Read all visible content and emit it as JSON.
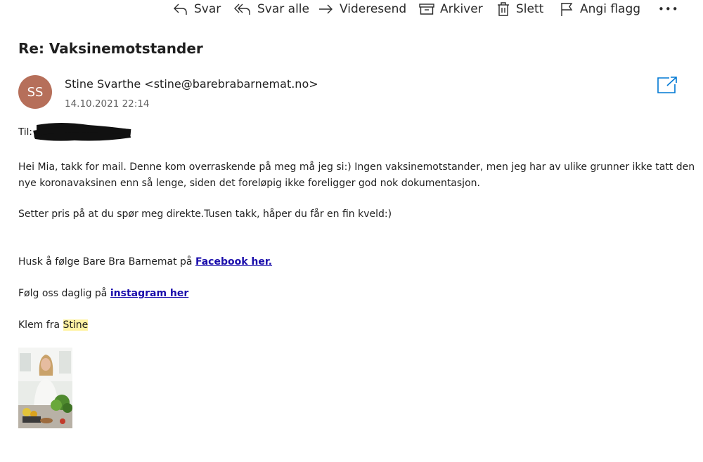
{
  "toolbar": {
    "reply": "Svar",
    "reply_all": "Svar alle",
    "forward": "Videresend",
    "archive": "Arkiver",
    "delete": "Slett",
    "flag": "Angi flagg",
    "more": "•••"
  },
  "message": {
    "subject": "Re: Vaksinemotstander",
    "avatar_initials": "SS",
    "sender": "Stine Svarthe <stine@barebrabarnemat.no>",
    "date": "14.10.2021 22:14",
    "to_label": "Til:",
    "body": {
      "line1": "Hei Mia, takk for mail. Denne kom overraskende på meg må jeg si:) Ingen vaksinemotstander, men jeg har av ulike grunner ikke tatt den",
      "line2": "nye koronavaksinen enn så lenge, siden det foreløpig ikke foreligger god nok dokumentasjon.",
      "line3": "Setter pris på at du spør meg direkte.Tusen takk, håper du får en fin kveld:)",
      "facebook_prefix": "Husk å følge Bare Bra Barnemat på ",
      "facebook_link": "Facebook her.",
      "instagram_prefix": "Følg oss daglig på ",
      "instagram_link": "instagram her",
      "signoff_prefix": "Klem fra ",
      "signoff_name": "Stine"
    }
  },
  "colors": {
    "avatar_bg": "#b66f5a",
    "accent": "#0078d4",
    "link": "#1a0dab",
    "highlight": "#fff3a3"
  },
  "icons": [
    "reply-icon",
    "reply-all-icon",
    "forward-icon",
    "archive-icon",
    "delete-icon",
    "flag-icon",
    "more-icon",
    "popout-icon"
  ]
}
